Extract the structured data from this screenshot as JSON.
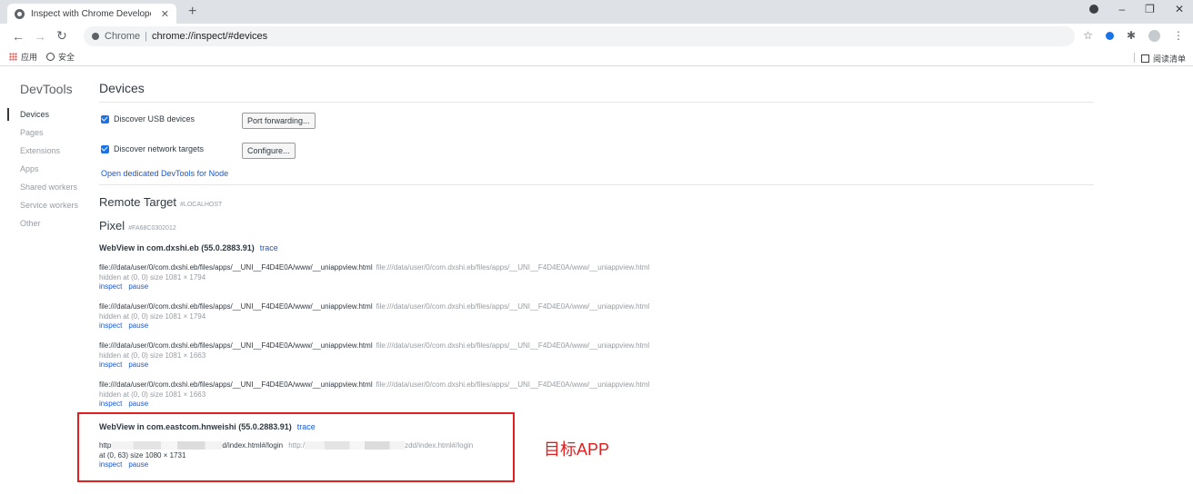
{
  "browser": {
    "tab_title": "Inspect with Chrome Developer Tools",
    "tab_close": "✕",
    "new_tab": "+",
    "omnibox_site": "Chrome",
    "omnibox_sep": "|",
    "omnibox_url": "chrome://inspect/#devices",
    "bookmarks": [
      "应用",
      "安全"
    ],
    "reading_list": "阅读清单",
    "icons": [
      "back-icon",
      "forward-icon",
      "reload-icon",
      "star-icon",
      "extension-icon",
      "puzzle-icon",
      "profile-icon",
      "menu-icon"
    ]
  },
  "sidebar": {
    "title": "DevTools",
    "items": [
      {
        "label": "Devices",
        "active": true
      },
      {
        "label": "Pages"
      },
      {
        "label": "Extensions"
      },
      {
        "label": "Apps"
      },
      {
        "label": "Shared workers"
      },
      {
        "label": "Service workers"
      },
      {
        "label": "Other"
      }
    ]
  },
  "devices": {
    "title": "Devices",
    "discover_usb": "Discover USB devices",
    "port_forwarding": "Port forwarding...",
    "discover_network": "Discover network targets",
    "configure": "Configure...",
    "node_link": "Open dedicated DevTools for Node"
  },
  "remote": {
    "title": "Remote Target",
    "host": "#LOCALHOST",
    "device_name": "Pixel",
    "device_serial": "#FA68C0302012"
  },
  "webview1": {
    "title": "WebView in com.dxshi.eb (55.0.2883.91)",
    "trace": "trace",
    "pages": [
      {
        "url": "file:///data/user/0/com.dxshi.eb/files/apps/__UNI__F4D4E0A/www/__uniappview.html",
        "url2": "file:///data/user/0/com.dxshi.eb/files/apps/__UNI__F4D4E0A/www/__uniappview.html",
        "meta": "hidden  at (0, 0)  size 1081 × 1794"
      },
      {
        "url": "file:///data/user/0/com.dxshi.eb/files/apps/__UNI__F4D4E0A/www/__uniappview.html",
        "url2": "file:///data/user/0/com.dxshi.eb/files/apps/__UNI__F4D4E0A/www/__uniappview.html",
        "meta": "hidden  at (0, 0)  size 1081 × 1794"
      },
      {
        "url": "file:///data/user/0/com.dxshi.eb/files/apps/__UNI__F4D4E0A/www/__uniappview.html",
        "url2": "file:///data/user/0/com.dxshi.eb/files/apps/__UNI__F4D4E0A/www/__uniappview.html",
        "meta": "hidden  at (0, 0)  size 1081 × 1663"
      },
      {
        "url": "file:///data/user/0/com.dxshi.eb/files/apps/__UNI__F4D4E0A/www/__uniappview.html",
        "url2": "file:///data/user/0/com.dxshi.eb/files/apps/__UNI__F4D4E0A/www/__uniappview.html",
        "meta": "hidden  at (0, 0)  size 1081 × 1663"
      }
    ],
    "inspect": "inspect",
    "pause": "pause"
  },
  "webview2": {
    "title": "WebView in com.eastcom.hnweishi (55.0.2883.91)",
    "trace": "trace",
    "url_prefix": "http",
    "url_suffix": "d/index.html#/login",
    "url2_prefix": "http:/",
    "url2_suffix": "zdd/index.html#/login",
    "meta": "at (0, 63)  size 1080 × 1731",
    "inspect": "inspect",
    "pause": "pause"
  },
  "annotation": {
    "label": "目标APP",
    "color": "#e02020"
  }
}
